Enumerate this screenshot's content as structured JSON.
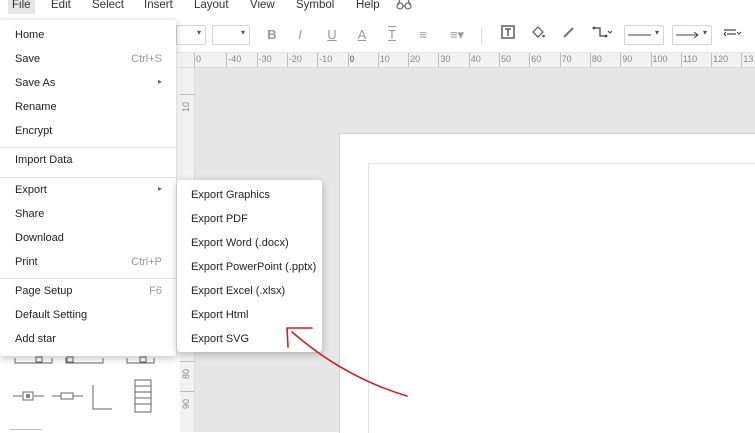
{
  "menubar": {
    "items": [
      "File",
      "Edit",
      "Select",
      "Insert",
      "Layout",
      "View",
      "Symbol",
      "Help"
    ],
    "extra_icon": "binoculars-icon"
  },
  "toolbar": {
    "icons": [
      "bold-icon",
      "italic-icon",
      "underline-icon",
      "font-color-icon",
      "text-style-icon",
      "align-icon",
      "line-spacing-icon",
      "text-box-icon",
      "fill-icon",
      "line-color-icon",
      "connector-icon",
      "line-style-icon",
      "arrow-style-icon",
      "more-icon"
    ]
  },
  "ruler": {
    "horizontal": [
      "0",
      "-40",
      "-30",
      "-20",
      "-10",
      "0",
      "10",
      "20",
      "30",
      "40",
      "50",
      "60",
      "70",
      "80",
      "90",
      "100",
      "110",
      "120",
      "13"
    ],
    "vertical": [
      "10",
      "80",
      "90"
    ]
  },
  "file_menu": {
    "items": [
      {
        "label": "Home",
        "shortcut": ""
      },
      {
        "label": "Save",
        "shortcut": "Ctrl+S"
      },
      {
        "label": "Save As",
        "shortcut": "",
        "arrow": "▸"
      },
      {
        "label": "Rename",
        "shortcut": ""
      },
      {
        "label": "Encrypt",
        "shortcut": ""
      },
      {
        "label": "Import Data",
        "shortcut": ""
      },
      {
        "label": "Export",
        "shortcut": "",
        "arrow": "▸"
      },
      {
        "label": "Share",
        "shortcut": ""
      },
      {
        "label": "Download",
        "shortcut": ""
      },
      {
        "label": "Print",
        "shortcut": "Ctrl+P"
      },
      {
        "label": "Page Setup",
        "shortcut": "F6"
      },
      {
        "label": "Default Setting",
        "shortcut": ""
      },
      {
        "label": "Add star",
        "shortcut": ""
      }
    ]
  },
  "export_submenu": {
    "items": [
      "Export Graphics",
      "Export PDF",
      "Export Word (.docx)",
      "Export PowerPoint (.pptx)",
      "Export Excel (.xlsx)",
      "Export Html",
      "Export SVG"
    ]
  },
  "colors": {
    "annotation_arrow": "#d42020",
    "canvas_bg": "#e6e6e6",
    "menu_active_bg": "#e6e6e6"
  }
}
